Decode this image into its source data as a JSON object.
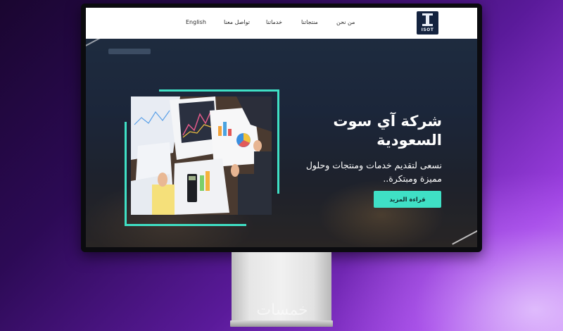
{
  "site": {
    "logo_text": "ISOT",
    "nav": [
      {
        "label": "من نحن"
      },
      {
        "label": "منتجاتنا"
      },
      {
        "label": "خدماتنا"
      },
      {
        "label": "تواصل معنا"
      },
      {
        "label": "English"
      }
    ]
  },
  "hero": {
    "title_line1": "شركة آي سوت",
    "title_line2": "السعودية",
    "subtitle_line1": "نسعى لتقديم خدمات ومنتجات وحلول",
    "subtitle_line2": "مميزة ومبتكرة..",
    "cta_label": "قراءة المزيد"
  },
  "watermark": "خمسات",
  "colors": {
    "accent": "#3fe0c5",
    "logo_bg": "#14233f",
    "header_bg": "#ffffff"
  }
}
